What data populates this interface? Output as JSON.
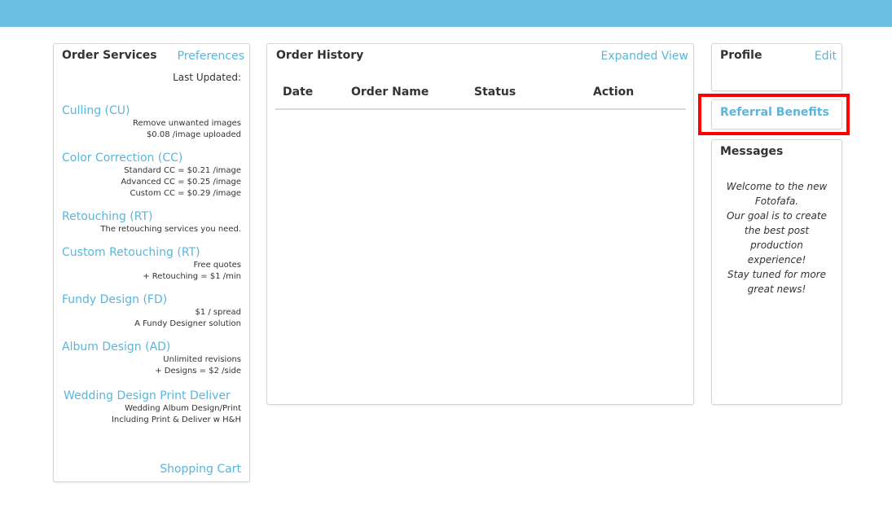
{
  "colors": {
    "topbar": "#6bbfe3",
    "link": "#5bb5dc",
    "highlight": "#ff0000"
  },
  "order_services": {
    "title": "Order Services",
    "preferences_link": "Preferences",
    "last_updated_label": "Last Updated:",
    "services": [
      {
        "name": "Culling (CU)",
        "desc": [
          "Remove unwanted images",
          "$0.08 /image uploaded"
        ]
      },
      {
        "name": "Color Correction (CC)",
        "desc": [
          "Standard CC = $0.21 /image",
          "Advanced CC = $0.25 /image",
          "Custom CC = $0.29 /image"
        ]
      },
      {
        "name": "Retouching (RT)",
        "desc": [
          "The retouching services you need."
        ]
      },
      {
        "name": "Custom Retouching (RT)",
        "desc": [
          "Free quotes",
          "+ Retouching = $1 /min"
        ]
      },
      {
        "name": "Fundy Design (FD)",
        "desc": [
          "$1 / spread",
          "A Fundy Designer solution"
        ]
      },
      {
        "name": "Album Design (AD)",
        "desc": [
          "Unlimited revisions",
          "+ Designs = $2 /side"
        ]
      },
      {
        "name": "Wedding Design Print Deliver",
        "desc": [
          "Wedding Album Design/Print",
          "Including Print & Deliver w H&H"
        ]
      }
    ],
    "shopping_cart_link": "Shopping Cart"
  },
  "order_history": {
    "title": "Order History",
    "expanded_view_link": "Expanded View",
    "columns": [
      "Date",
      "Order Name",
      "Status",
      "Action"
    ]
  },
  "profile": {
    "title": "Profile",
    "edit_link": "Edit"
  },
  "referral": {
    "label": "Referral Benefits"
  },
  "messages": {
    "title": "Messages",
    "lines": [
      "Welcome to the new",
      "Fotofafa.",
      "Our goal is to create",
      "the best post",
      "production",
      "experience!",
      "Stay tuned for more",
      "great news!"
    ]
  }
}
